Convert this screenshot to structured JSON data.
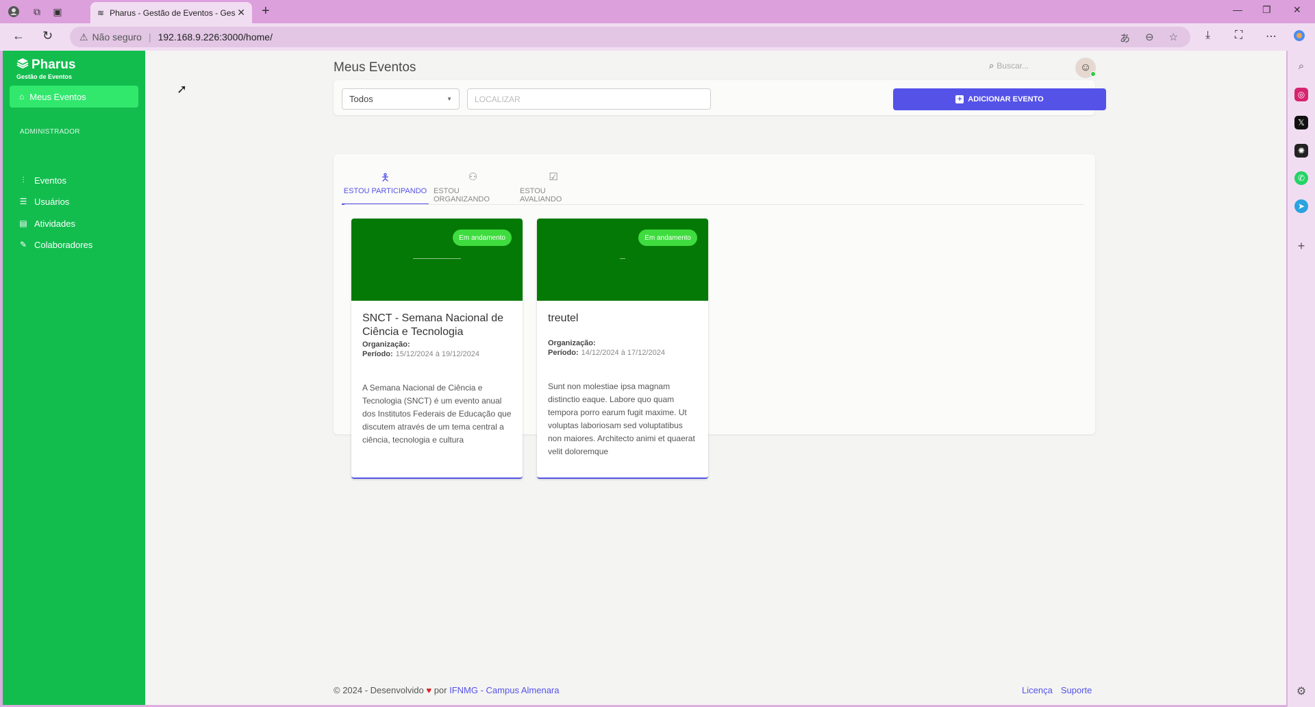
{
  "browser": {
    "tab_title": "Pharus - Gestão de Eventos - Ges",
    "security_label": "Não seguro",
    "url": "192.168.9.226:3000/home/"
  },
  "sidebar": {
    "logo_title": "Pharus",
    "logo_subtitle": "Gestão de Eventos",
    "active_item": "Meus Eventos",
    "section_label": "ADMINISTRADOR",
    "items": [
      {
        "label": "Eventos",
        "icon": "chart-icon"
      },
      {
        "label": "Usuários",
        "icon": "list-icon"
      },
      {
        "label": "Atividades",
        "icon": "book-icon"
      },
      {
        "label": "Colaboradores",
        "icon": "pencil-icon"
      }
    ]
  },
  "header": {
    "title": "Meus Eventos",
    "search_placeholder": "Buscar..."
  },
  "filters": {
    "select_value": "Todos",
    "locate_placeholder": "LOCALIZAR",
    "add_button": "ADICIONAR EVENTO"
  },
  "tabs": [
    {
      "label": "ESTOU PARTICIPANDO",
      "active": true
    },
    {
      "label": "ESTOU ORGANIZANDO",
      "active": false
    },
    {
      "label": "ESTOU AVALIANDO",
      "active": false
    }
  ],
  "events": [
    {
      "badge": "Em andamento",
      "title": "SNCT - Semana Nacional de Ciência e Tecnologia",
      "org_label": "Organização:",
      "period_label": "Período:",
      "period": "15/12/2024 à 19/12/2024",
      "description": "A Semana Nacional de Ciência e Tecnologia (SNCT) é um evento anual dos Institutos Federais de Educação que discutem através de um tema central a ciência, tecnologia e cultura"
    },
    {
      "badge": "Em andamento",
      "title": "treutel",
      "org_label": "Organização:",
      "period_label": "Período:",
      "period": "14/12/2024 à 17/12/2024",
      "description": "Sunt non molestiae ipsa magnam distinctio eaque. Labore quo quam tempora porro earum fugit maxime. Ut voluptas laboriosam sed voluptatibus non maiores. Architecto animi et quaerat velit doloremque"
    }
  ],
  "footer": {
    "prefix": "© 2024 - Desenvolvido",
    "by": "por",
    "org_link": "IFNMG - Campus Almenara",
    "license": "Licença",
    "support": "Suporte"
  },
  "colors": {
    "sidebar": "#12bd4e",
    "accent": "#5552e8",
    "badge": "#3fdc3f",
    "cover": "#057905"
  }
}
